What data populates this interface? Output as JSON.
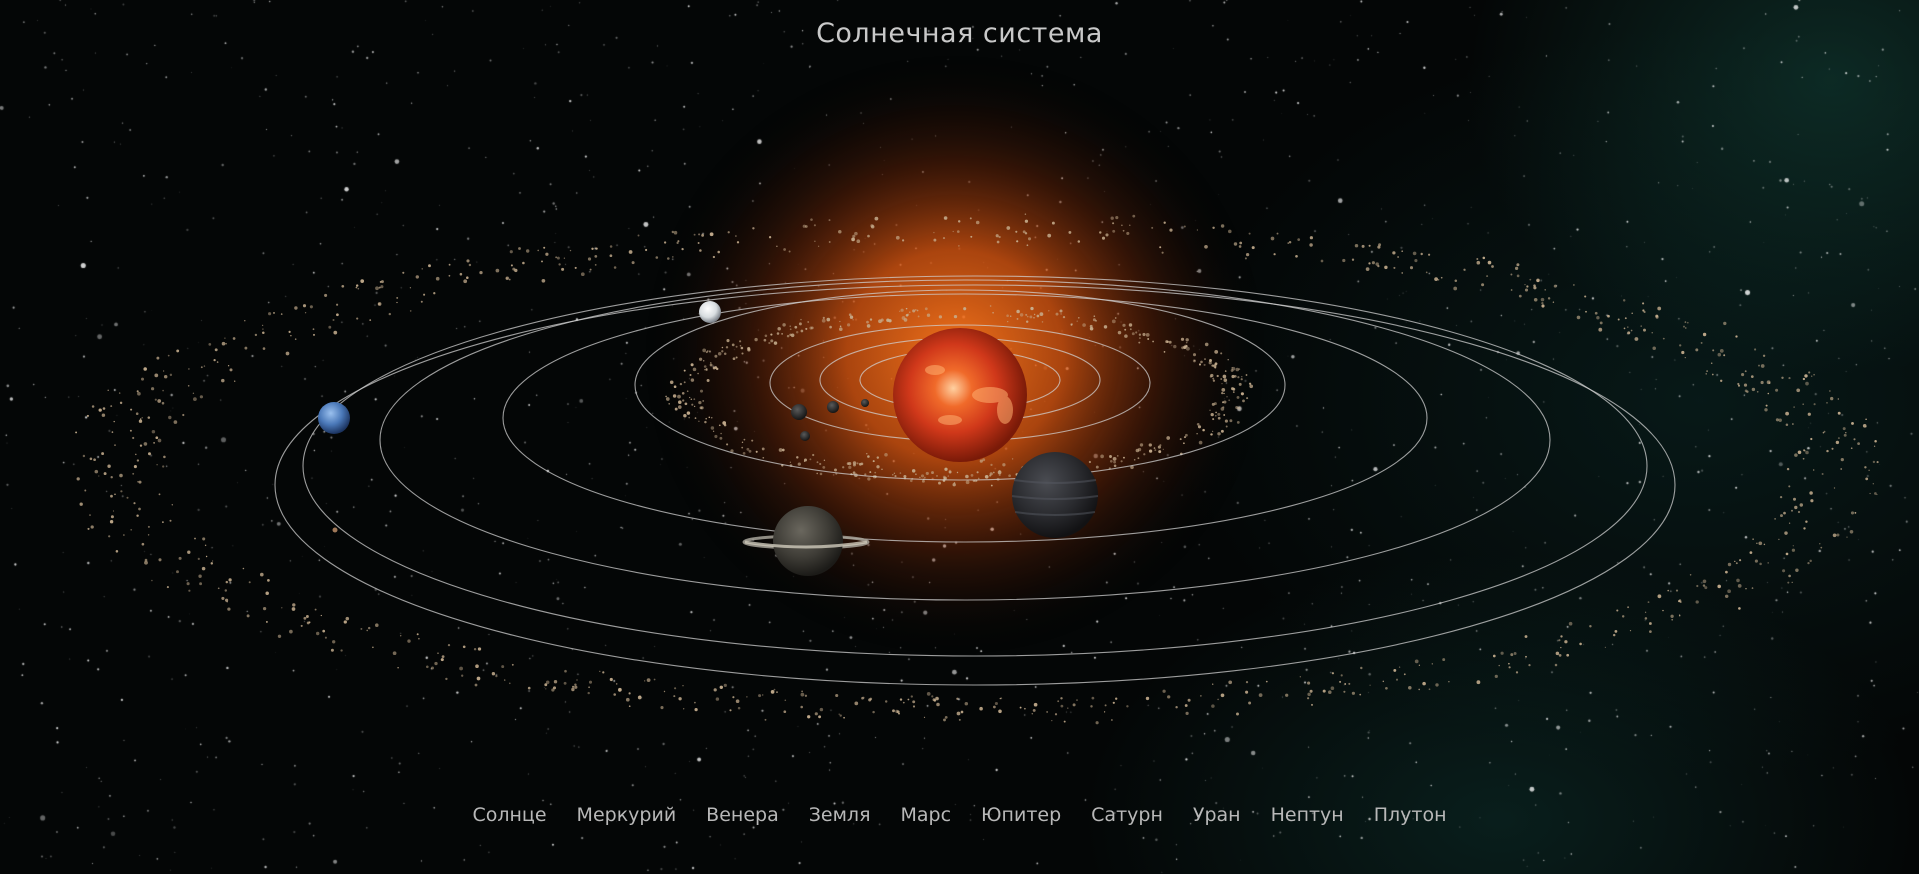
{
  "page": {
    "title": "Солнечная система"
  },
  "nav": {
    "items": [
      {
        "label": "Солнце"
      },
      {
        "label": "Меркурий"
      },
      {
        "label": "Венера"
      },
      {
        "label": "Земля"
      },
      {
        "label": "Марс"
      },
      {
        "label": "Юпитер"
      },
      {
        "label": "Сатурн"
      },
      {
        "label": "Уран"
      },
      {
        "label": "Нептун"
      },
      {
        "label": "Плутон"
      }
    ]
  },
  "colors": {
    "background": "#040606",
    "sun_glow": "#e8641a",
    "sun_surface": "#d8401a",
    "orbit_line": "#d8d8d8",
    "asteroid": "#c8b090",
    "nav_text": "#b8b8b8",
    "title_text": "#c9c9c9"
  },
  "icons": {
    "sun": "sun-icon",
    "planets": [
      "mercury-icon",
      "venus-icon",
      "earth-icon",
      "mars-icon",
      "jupiter-icon",
      "saturn-icon",
      "uranus-icon",
      "neptune-icon",
      "pluto-icon"
    ]
  }
}
